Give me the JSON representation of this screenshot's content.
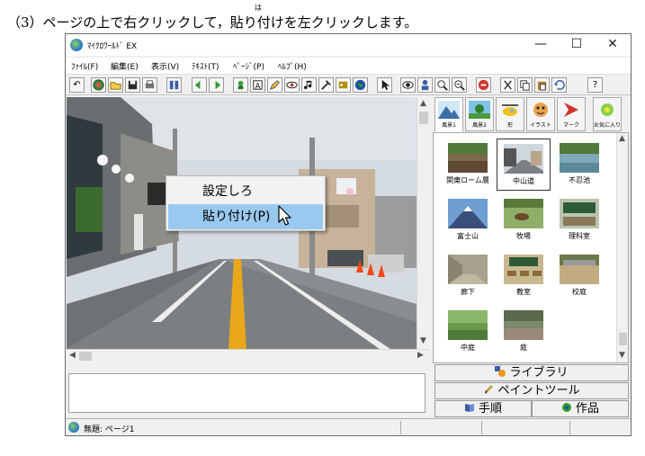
{
  "instruction": {
    "text": "（3）ページの上で右クリックして，貼り付けを左クリックします。",
    "ruby": "は"
  },
  "window": {
    "title": "ﾏｲｸﾛﾜｰﾙﾄﾞ EX",
    "controls": {
      "minimize": "—",
      "maximize": "☐",
      "close": "✕"
    }
  },
  "menu": [
    "ﾌｧｲﾙ(F)",
    "編集(E)",
    "表示(V)",
    "ﾃｷｽﾄ(T)",
    "ﾍﾟｰｼﾞ(P)",
    "ﾍﾙﾌﾟ(H)"
  ],
  "toolbar": {
    "first": "↶",
    "help": "?"
  },
  "context_menu": {
    "items": [
      "設定しろ",
      "貼り付け(P)"
    ],
    "highlighted": "貼り付け(P)"
  },
  "library": {
    "categories": [
      "風景1",
      "風景2",
      "形",
      "イラスト",
      "マーク",
      "お気に入り"
    ],
    "active_category": "風景1",
    "items": [
      "関東ローム層",
      "中山道",
      "不忍池",
      "富士山",
      "牧場",
      "理科室",
      "廊下",
      "教室",
      "校庭",
      "中庭",
      "庭"
    ],
    "selected_item": "中山道"
  },
  "side_buttons": {
    "library": "ライブラリ",
    "paint": "ペイントツール",
    "steps": "手順",
    "works": "作品"
  },
  "status": {
    "text": "無題: ページ1"
  },
  "colors": {
    "selection": "#99c9ef",
    "window_bg": "#f0f0f0"
  }
}
